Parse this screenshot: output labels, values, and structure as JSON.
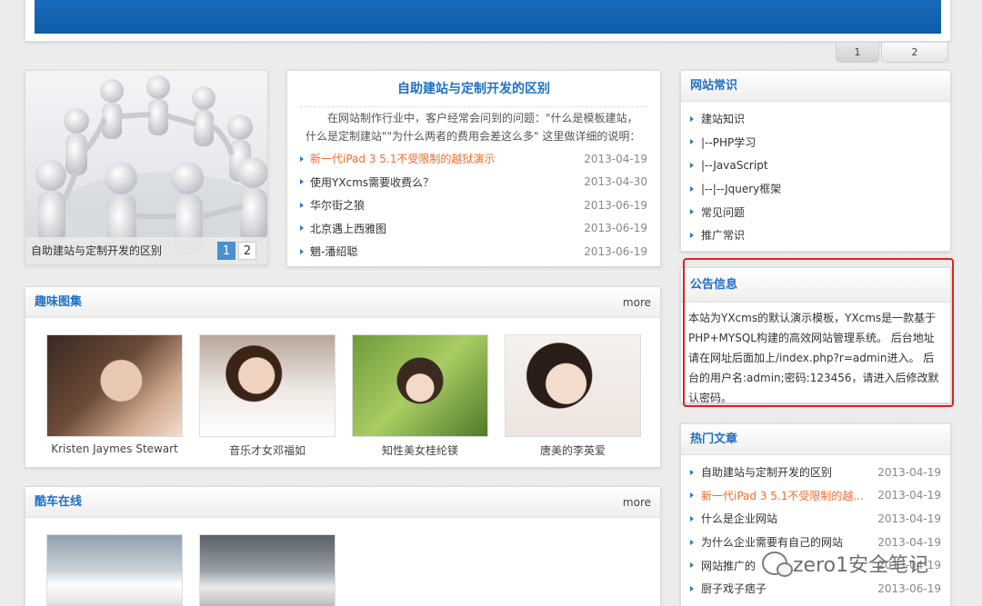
{
  "pager_top": [
    "1",
    "2"
  ],
  "slideshow": {
    "caption": "自助建站与定制开发的区别",
    "pages": [
      "1",
      "2"
    ]
  },
  "headline": {
    "title": "自助建站与定制开发的区别",
    "description": "在网站制作行业中，客户经常会问到的问题：\"什么是模板建站，什么是定制建站\"\"为什么两者的费用会差这么多\" 这里做详细的说明：",
    "news": [
      {
        "title": "新一代iPad 3 5.1不受限制的越狱演示",
        "date": "2013-04-19",
        "hot": true
      },
      {
        "title": "使用YXcms需要收费么？",
        "date": "2013-04-30",
        "hot": false
      },
      {
        "title": "华尔街之狼",
        "date": "2013-06-19",
        "hot": false
      },
      {
        "title": "北京遇上西雅图",
        "date": "2013-06-19",
        "hot": false
      },
      {
        "title": "魍-潘绍聪",
        "date": "2013-06-19",
        "hot": false
      }
    ]
  },
  "gallery": {
    "title": "趣味图集",
    "more": "more",
    "items": [
      {
        "caption": "Kristen Jaymes Stewart"
      },
      {
        "caption": "音乐才女邓福如"
      },
      {
        "caption": "知性美女桂纶镁"
      },
      {
        "caption": "唐美的李英爱"
      }
    ]
  },
  "cars": {
    "title": "酷车在线",
    "more": "more"
  },
  "knowledge": {
    "title": "网站常识",
    "items": [
      "建站知识",
      "|--PHP学习",
      "|--JavaScript",
      "|--|--Jquery框架",
      "常见问题",
      "推广常识"
    ]
  },
  "notice": {
    "title": "公告信息",
    "body": "本站为YXcms的默认演示模板，YXcms是一款基于PHP+MYSQL构建的高效网站管理系统。 后台地址请在网址后面加上/index.php?r=admin进入。 后台的用户名:admin;密码:123456，请进入后修改默认密码。"
  },
  "hot_articles": {
    "title": "热门文章",
    "items": [
      {
        "title": "自助建站与定制开发的区别",
        "date": "2013-04-19",
        "hot": false
      },
      {
        "title": "新一代iPad 3 5.1不受限制的越...",
        "date": "2013-04-19",
        "hot": true
      },
      {
        "title": "什么是企业网站",
        "date": "2013-04-19",
        "hot": false
      },
      {
        "title": "为什么企业需要有自己的网站",
        "date": "2013-04-19",
        "hot": false
      },
      {
        "title": "网站推广的",
        "date": "2013-04-19",
        "hot": false
      },
      {
        "title": "厨子戏子痞子",
        "date": "2013-06-19",
        "hot": false
      }
    ]
  },
  "watermark": "zero1安全笔记",
  "colors": {
    "accent": "#1f6fc4",
    "hot": "#f26b2b",
    "banner": "#0f5ca8",
    "highlight": "#e02020"
  }
}
